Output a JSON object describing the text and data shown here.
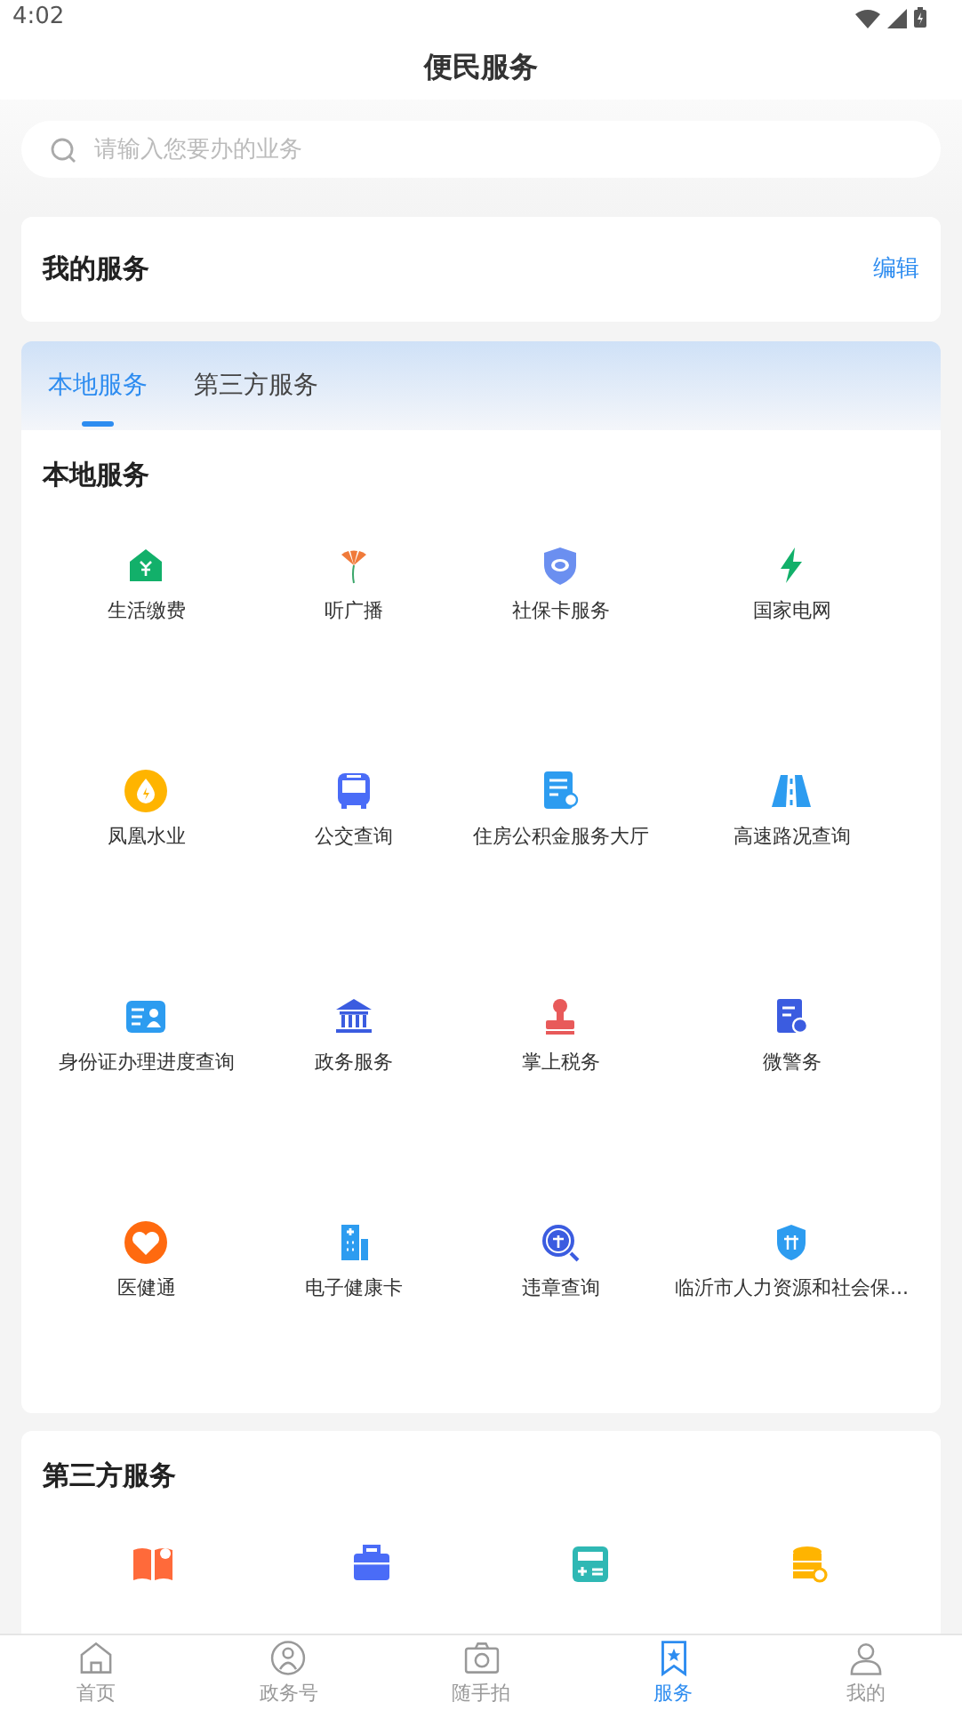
{
  "status_bar": {
    "time": "4:02"
  },
  "title": "便民服务",
  "search": {
    "placeholder": "请输入您要办的业务"
  },
  "my_services": {
    "title": "我的服务",
    "action": "编辑"
  },
  "tabs": [
    {
      "label": "本地服务",
      "selected": true
    },
    {
      "label": "第三方服务",
      "selected": false
    }
  ],
  "sections": [
    {
      "title": "本地服务",
      "items": [
        {
          "label": "生活缴费"
        },
        {
          "label": "听广播"
        },
        {
          "label": "社保卡服务"
        },
        {
          "label": "国家电网"
        },
        {
          "label": "凤凰水业"
        },
        {
          "label": "公交查询"
        },
        {
          "label": "住房公积金服务大厅"
        },
        {
          "label": "高速路况查询"
        },
        {
          "label": "身份证办理进度查询"
        },
        {
          "label": "政务服务"
        },
        {
          "label": "掌上税务"
        },
        {
          "label": "微警务"
        },
        {
          "label": "医健通"
        },
        {
          "label": "电子健康卡"
        },
        {
          "label": "违章查询"
        },
        {
          "label": "临沂市人力资源和社会保..."
        }
      ]
    },
    {
      "title": "第三方服务",
      "items": [
        {
          "kind": "icon-only"
        },
        {
          "kind": "icon-only"
        },
        {
          "kind": "icon-only"
        },
        {
          "kind": "icon-only"
        }
      ]
    }
  ],
  "bottom_nav": [
    {
      "label": "首页",
      "selected": false
    },
    {
      "label": "政务号",
      "selected": false
    },
    {
      "label": "随手拍",
      "selected": false
    },
    {
      "label": "服务",
      "selected": true
    },
    {
      "label": "我的",
      "selected": false
    }
  ]
}
